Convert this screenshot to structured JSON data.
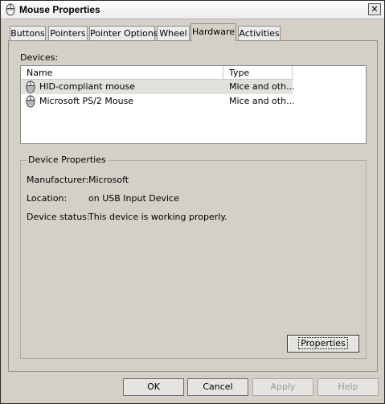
{
  "window": {
    "title": "Mouse Properties",
    "title_icon": "mouse-icon",
    "close_glyph": "✕"
  },
  "tabs": [
    {
      "label": "Buttons",
      "active": false
    },
    {
      "label": "Pointers",
      "active": false
    },
    {
      "label": "Pointer Options",
      "active": false
    },
    {
      "label": "Wheel",
      "active": false
    },
    {
      "label": "Hardware",
      "active": true
    },
    {
      "label": "Activities",
      "active": false
    }
  ],
  "hardware": {
    "devices_label": "Devices:",
    "columns": {
      "name": "Name",
      "type": "Type"
    },
    "devices": [
      {
        "name": "HID-compliant mouse",
        "type": "Mice and oth...",
        "icon": "mouse-icon",
        "selected": true
      },
      {
        "name": "Microsoft PS/2 Mouse",
        "type": "Mice and oth...",
        "icon": "mouse-icon",
        "selected": false
      }
    ],
    "device_properties": {
      "title": "Device Properties",
      "manufacturer_label": "Manufacturer:",
      "manufacturer": "Microsoft",
      "location_label": "Location:",
      "location": "on USB Input Device",
      "status_label": "Device status:",
      "status": "This device is working properly."
    },
    "properties_button": "Properties"
  },
  "dialog_buttons": {
    "ok": "OK",
    "cancel": "Cancel",
    "apply": "Apply",
    "help": "Help"
  },
  "colors": {
    "dialog_bg": "#d4d0c8",
    "selection": "#e2e0dc"
  }
}
